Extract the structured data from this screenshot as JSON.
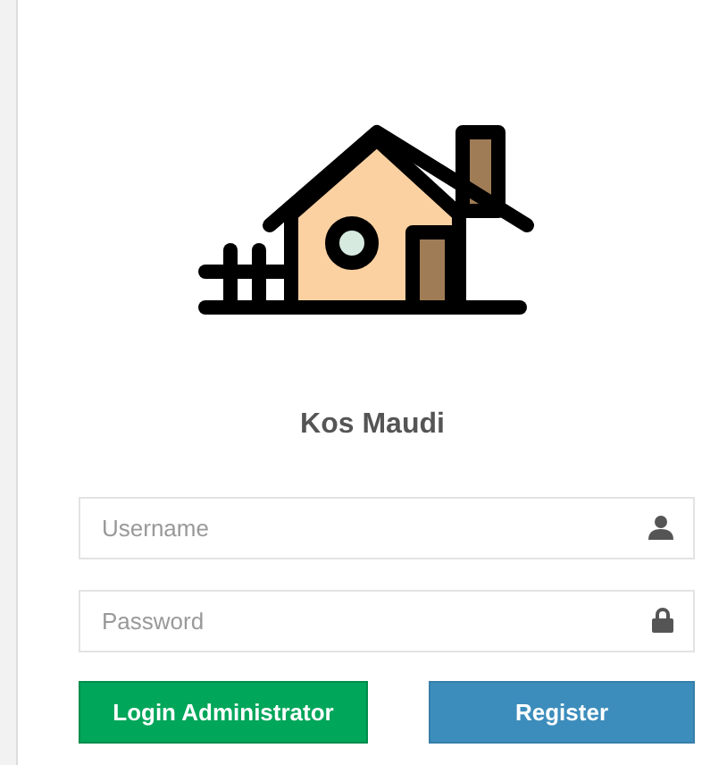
{
  "title": "Kos Maudi",
  "fields": [
    {
      "kind": "user",
      "placeholder": "Username"
    },
    {
      "kind": "lock",
      "placeholder": "Password"
    }
  ],
  "buttons": [
    {
      "kind": "login",
      "label": "Login Administrator"
    },
    {
      "kind": "register",
      "label": "Register"
    }
  ]
}
